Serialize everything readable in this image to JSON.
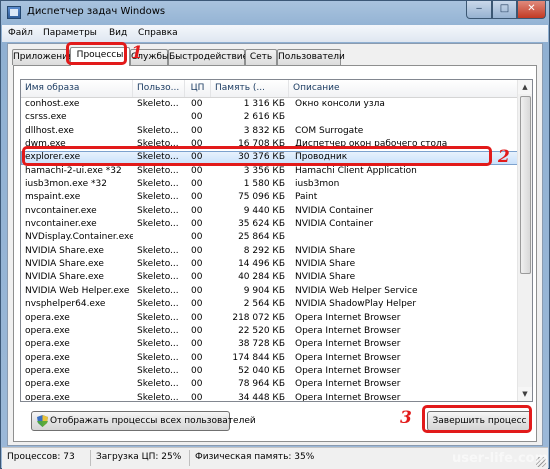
{
  "window": {
    "title": "Диспетчер задач Windows",
    "minimize_glyph": "‒",
    "maximize_glyph": "□",
    "close_glyph": "✕"
  },
  "menu": [
    "Файл",
    "Параметры",
    "Вид",
    "Справка"
  ],
  "tabs": [
    "Приложения",
    "Процессы",
    "Службы",
    "Быстродействие",
    "Сеть",
    "Пользователи"
  ],
  "active_tab": "Процессы",
  "columns": {
    "name": "Имя образа",
    "user": "Пользо...",
    "cpu": "ЦП",
    "memory": "Память (...",
    "description": "Описание"
  },
  "processes": [
    {
      "name": "conhost.exe",
      "user": "Skeleto...",
      "cpu": "00",
      "memory": "1 316 КБ",
      "description": "Окно консоли узла"
    },
    {
      "name": "csrss.exe",
      "user": "",
      "cpu": "00",
      "memory": "2 616 КБ",
      "description": ""
    },
    {
      "name": "dllhost.exe",
      "user": "Skeleto...",
      "cpu": "00",
      "memory": "3 832 КБ",
      "description": "COM Surrogate"
    },
    {
      "name": "dwm.exe",
      "user": "Skeleto...",
      "cpu": "00",
      "memory": "16 708 КБ",
      "description": "Диспетчер окон рабочего стола"
    },
    {
      "name": "explorer.exe",
      "user": "Skeleto...",
      "cpu": "00",
      "memory": "30 376 КБ",
      "description": "Проводник"
    },
    {
      "name": "hamachi-2-ui.exe *32",
      "user": "Skeleto...",
      "cpu": "00",
      "memory": "3 356 КБ",
      "description": "Hamachi Client Application"
    },
    {
      "name": "iusb3mon.exe *32",
      "user": "Skeleto...",
      "cpu": "00",
      "memory": "1 580 КБ",
      "description": "iusb3mon"
    },
    {
      "name": "mspaint.exe",
      "user": "Skeleto...",
      "cpu": "00",
      "memory": "75 096 КБ",
      "description": "Paint"
    },
    {
      "name": "nvcontainer.exe",
      "user": "Skeleto...",
      "cpu": "00",
      "memory": "9 440 КБ",
      "description": "NVIDIA Container"
    },
    {
      "name": "nvcontainer.exe",
      "user": "Skeleto...",
      "cpu": "00",
      "memory": "35 624 КБ",
      "description": "NVIDIA Container"
    },
    {
      "name": "NVDisplay.Container.exe",
      "user": "",
      "cpu": "00",
      "memory": "25 864 КБ",
      "description": ""
    },
    {
      "name": "NVIDIA Share.exe",
      "user": "Skeleto...",
      "cpu": "00",
      "memory": "8 292 КБ",
      "description": "NVIDIA Share"
    },
    {
      "name": "NVIDIA Share.exe",
      "user": "Skeleto...",
      "cpu": "00",
      "memory": "14 496 КБ",
      "description": "NVIDIA Share"
    },
    {
      "name": "NVIDIA Share.exe",
      "user": "Skeleto...",
      "cpu": "00",
      "memory": "40 284 КБ",
      "description": "NVIDIA Share"
    },
    {
      "name": "NVIDIA Web Helper.exe ...",
      "user": "Skeleto...",
      "cpu": "00",
      "memory": "9 904 КБ",
      "description": "NVIDIA Web Helper Service"
    },
    {
      "name": "nvsphelper64.exe",
      "user": "Skeleto...",
      "cpu": "00",
      "memory": "2 564 КБ",
      "description": "NVIDIA ShadowPlay Helper"
    },
    {
      "name": "opera.exe",
      "user": "Skeleto...",
      "cpu": "00",
      "memory": "218 072 КБ",
      "description": "Opera Internet Browser"
    },
    {
      "name": "opera.exe",
      "user": "Skeleto...",
      "cpu": "00",
      "memory": "22 520 КБ",
      "description": "Opera Internet Browser"
    },
    {
      "name": "opera.exe",
      "user": "Skeleto...",
      "cpu": "00",
      "memory": "38 728 КБ",
      "description": "Opera Internet Browser"
    },
    {
      "name": "opera.exe",
      "user": "Skeleto...",
      "cpu": "00",
      "memory": "174 844 КБ",
      "description": "Opera Internet Browser"
    },
    {
      "name": "opera.exe",
      "user": "Skeleto...",
      "cpu": "00",
      "memory": "52 040 КБ",
      "description": "Opera Internet Browser"
    },
    {
      "name": "opera.exe",
      "user": "Skeleto...",
      "cpu": "00",
      "memory": "78 964 КБ",
      "description": "Opera Internet Browser"
    },
    {
      "name": "opera.exe",
      "user": "Skeleto...",
      "cpu": "00",
      "memory": "34 448 КБ",
      "description": "Opera Internet Browser"
    }
  ],
  "selected_process": "explorer.exe",
  "buttons": {
    "show_all": "Отображать процессы всех пользователей",
    "end_process": "Завершить процесс"
  },
  "status": {
    "processes": "Процессов: 73",
    "cpu": "Загрузка ЦП: 25%",
    "memory": "Физическая память: 35%"
  },
  "annotations": {
    "step1": "1",
    "step2": "2",
    "step3": "3",
    "color": "#e21a1a"
  },
  "watermark": "user-life.com"
}
